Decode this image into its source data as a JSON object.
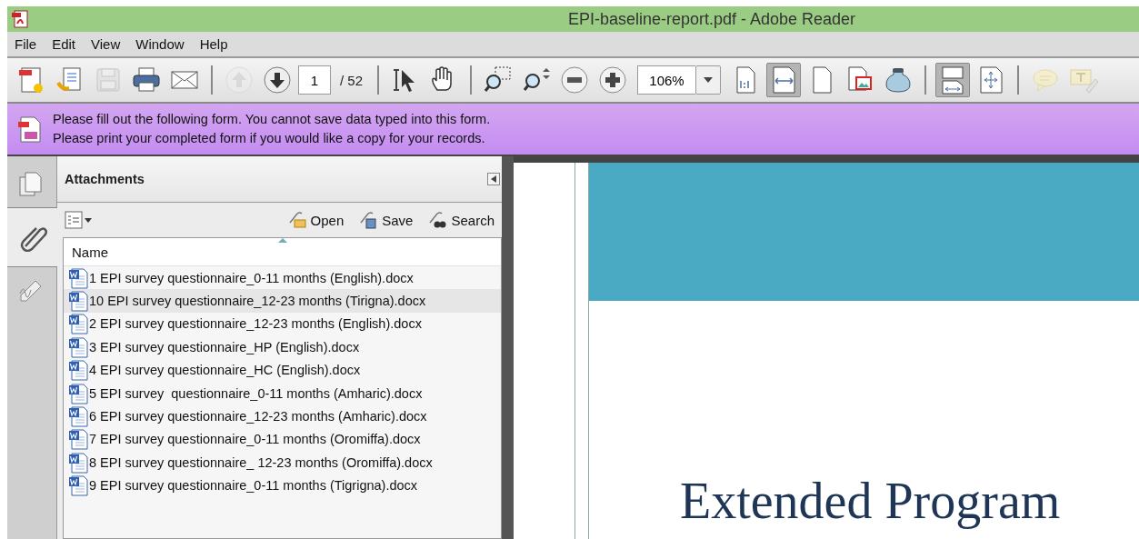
{
  "window": {
    "title": "EPI-baseline-report.pdf - Adobe Reader"
  },
  "menu": [
    "File",
    "Edit",
    "View",
    "Window",
    "Help"
  ],
  "toolbar": [
    {
      "kind": "button",
      "disabled": false,
      "selected": false
    },
    {
      "kind": "button",
      "disabled": false,
      "selected": false
    },
    {
      "kind": "button",
      "disabled": true,
      "selected": false
    },
    {
      "kind": "button",
      "disabled": false,
      "selected": false
    },
    {
      "kind": "button",
      "disabled": false,
      "selected": false
    },
    {
      "kind": "separator"
    },
    {
      "kind": "button",
      "disabled": true,
      "selected": false
    },
    {
      "kind": "button",
      "disabled": false,
      "selected": false
    },
    {
      "kind": "page-field",
      "value": "1"
    },
    {
      "kind": "page-count",
      "text": "/ 52"
    },
    {
      "kind": "separator"
    },
    {
      "kind": "button",
      "disabled": false,
      "selected": false
    },
    {
      "kind": "button",
      "disabled": false,
      "selected": false
    },
    {
      "kind": "separator"
    },
    {
      "kind": "button",
      "disabled": false,
      "selected": false
    },
    {
      "kind": "button",
      "disabled": false,
      "selected": false
    },
    {
      "kind": "button",
      "disabled": false,
      "selected": false
    },
    {
      "kind": "button",
      "disabled": false,
      "selected": false
    },
    {
      "kind": "zoom-field",
      "value": "106%"
    },
    {
      "kind": "button",
      "disabled": false,
      "selected": false
    },
    {
      "kind": "button",
      "disabled": false,
      "selected": true
    },
    {
      "kind": "button",
      "disabled": false,
      "selected": false
    },
    {
      "kind": "button",
      "disabled": false,
      "selected": false
    },
    {
      "kind": "button",
      "disabled": false,
      "selected": false
    },
    {
      "kind": "separator"
    },
    {
      "kind": "button",
      "disabled": false,
      "selected": true
    },
    {
      "kind": "button",
      "disabled": false,
      "selected": false
    },
    {
      "kind": "separator"
    },
    {
      "kind": "button",
      "disabled": true,
      "selected": false
    },
    {
      "kind": "button",
      "disabled": true,
      "selected": false
    }
  ],
  "banner": {
    "lines": [
      "Please fill out the following form. You cannot save data typed into this form.",
      "Please print your completed form if you would like a copy for your records."
    ]
  },
  "nav_tabs": [
    {
      "selected": false
    },
    {
      "selected": true
    },
    {
      "selected": false
    }
  ],
  "attachments": {
    "title": "Attachments",
    "actions": [
      "Open",
      "Save",
      "Search"
    ],
    "column": "Name",
    "rows": [
      {
        "name": "1 EPI survey questionnaire_0-11 months (English).docx",
        "selected": false
      },
      {
        "name": "10 EPI survey questionnaire_12-23 months (Tirigna).docx",
        "selected": true
      },
      {
        "name": "2 EPI survey questionnaire_12-23 months (English).docx",
        "selected": false
      },
      {
        "name": "3 EPI survey questionnaire_HP (English).docx",
        "selected": false
      },
      {
        "name": "4 EPI survey questionnaire_HC (English).docx",
        "selected": false
      },
      {
        "name": "5 EPI survey  questionnaire_0-11 months (Amharic).docx",
        "selected": false
      },
      {
        "name": "6 EPI survey questionnaire_12-23 months (Amharic).docx",
        "selected": false
      },
      {
        "name": "7 EPI survey questionnaire_0-11 months (Oromiffa).docx",
        "selected": false
      },
      {
        "name": "8 EPI survey questionnaire_ 12-23 months (Oromiffa).docx",
        "selected": false
      },
      {
        "name": "9 EPI survey questionnaire_0-11 months (Tigrigna).docx",
        "selected": false
      }
    ]
  },
  "document": {
    "heading": "Extended Program"
  }
}
